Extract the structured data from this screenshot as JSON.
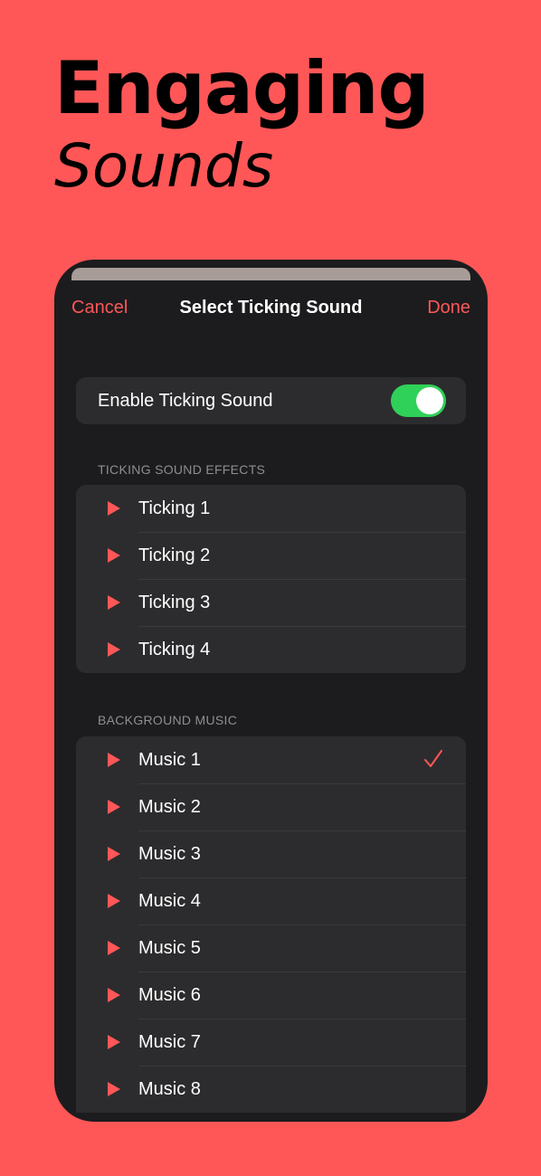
{
  "headline": {
    "line1": "Engaging",
    "line2": "Sounds"
  },
  "navbar": {
    "cancel_label": "Cancel",
    "title": "Select Ticking Sound",
    "done_label": "Done"
  },
  "toggle": {
    "label": "Enable Ticking Sound",
    "enabled": true
  },
  "ticking_section": {
    "header": "TICKING SOUND EFFECTS",
    "items": [
      {
        "label": "Ticking 1"
      },
      {
        "label": "Ticking 2"
      },
      {
        "label": "Ticking 3"
      },
      {
        "label": "Ticking 4"
      }
    ]
  },
  "music_section": {
    "header": "BACKGROUND MUSIC",
    "items": [
      {
        "label": "Music 1",
        "selected": true
      },
      {
        "label": "Music 2"
      },
      {
        "label": "Music 3"
      },
      {
        "label": "Music 4"
      },
      {
        "label": "Music 5"
      },
      {
        "label": "Music 6"
      },
      {
        "label": "Music 7"
      },
      {
        "label": "Music 8"
      }
    ]
  },
  "colors": {
    "background": "#FF5757",
    "accent": "#FF5757",
    "screen": "#1C1C1E",
    "cell": "#2C2C2E",
    "switch_on": "#30D158"
  },
  "icons": {
    "row_icon": "play-icon",
    "selected_icon": "checkmark-icon"
  }
}
